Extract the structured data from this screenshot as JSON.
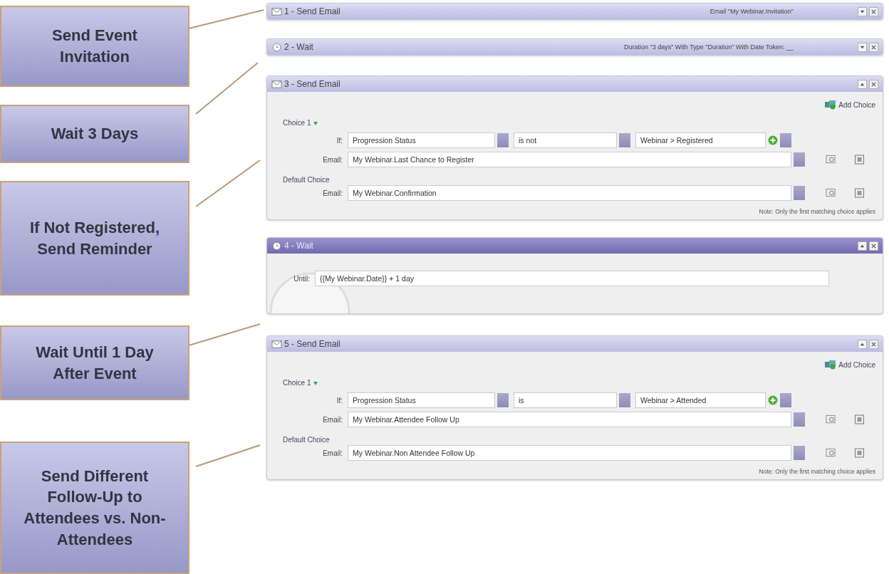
{
  "callouts": [
    "Send Event Invitation",
    "Wait 3 Days",
    "If Not Registered, Send Reminder",
    "Wait Until 1 Day After Event",
    "Send Different Follow-Up to Attendees vs. Non-Attendees"
  ],
  "steps": [
    {
      "kind": "email",
      "title": "1 - Send Email",
      "expanded": false,
      "selected": false,
      "summary": "Email \"My Webinar.Invitation\""
    },
    {
      "kind": "wait",
      "title": "2 - Wait",
      "expanded": false,
      "selected": false,
      "summary": "Duration \"3 days\" With Type \"Duration\" With Date Token: __"
    },
    {
      "kind": "email",
      "title": "3 - Send Email",
      "expanded": true,
      "selected": false,
      "add_choice": "Add Choice",
      "choice_label": "Choice 1",
      "if_label": "If:",
      "attribute": "Progression Status",
      "operator": "is not",
      "value": "Webinar > Registered",
      "email_label": "Email:",
      "email": "My Webinar.Last Chance to Register",
      "default_label": "Default Choice",
      "default_email_label": "Email:",
      "default_email": "My Webinar.Confirmation",
      "note": "Note: Only the first matching choice applies"
    },
    {
      "kind": "wait",
      "title": "4 - Wait",
      "expanded": true,
      "selected": true,
      "until_label": "Until:",
      "until": "{{My Webinar.Date}} + 1 day"
    },
    {
      "kind": "email",
      "title": "5 - Send Email",
      "expanded": true,
      "selected": false,
      "add_choice": "Add Choice",
      "choice_label": "Choice 1",
      "if_label": "If:",
      "attribute": "Progression Status",
      "operator": "is",
      "value": "Webinar > Attended",
      "email_label": "Email:",
      "email": "My Webinar.Attendee Follow Up",
      "default_label": "Default Choice",
      "default_email_label": "Email:",
      "default_email": "My Webinar.Non Attendee Follow Up",
      "note": "Note: Only the first matching choice applies"
    }
  ]
}
